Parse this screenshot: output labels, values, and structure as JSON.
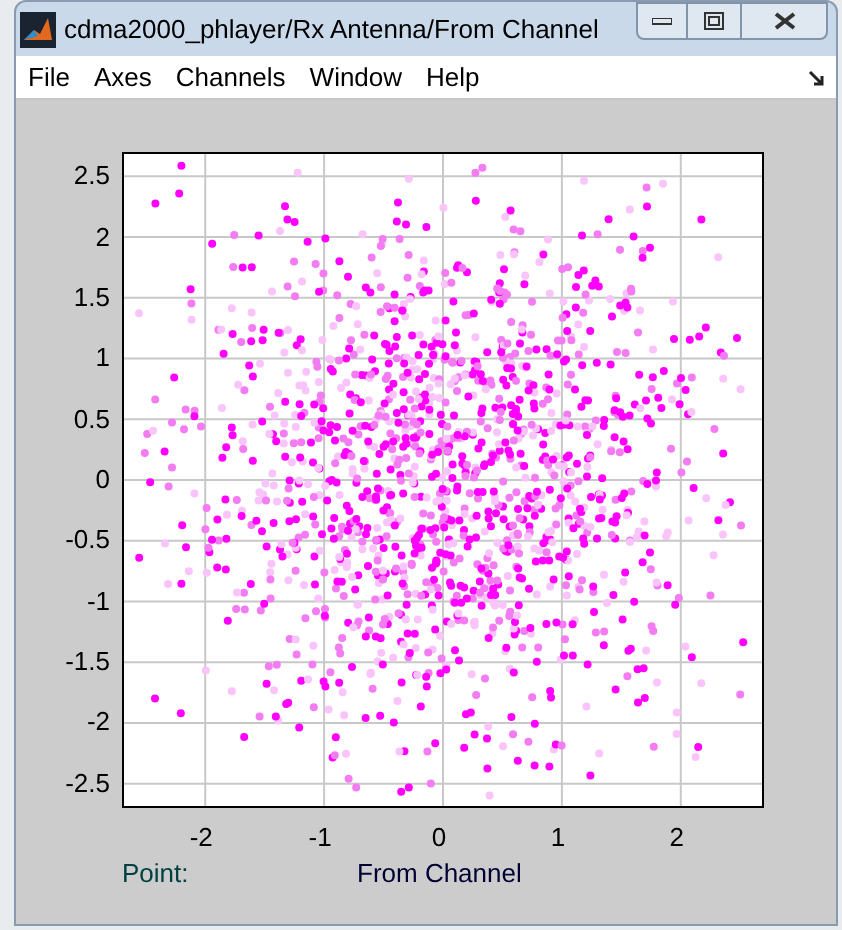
{
  "window": {
    "title": "cdma2000_phlayer/Rx Antenna/From Channel"
  },
  "menu": [
    "File",
    "Axes",
    "Channels",
    "Window",
    "Help"
  ],
  "plot": {
    "chart_data": {
      "type": "scatter",
      "grid": true,
      "xlabel": "From Channel",
      "xlim": [
        -2.7,
        2.7
      ],
      "ylim": [
        -2.7,
        2.7
      ],
      "xticks": [
        -2,
        -1,
        0,
        1,
        2
      ],
      "yticks": [
        -2.5,
        -2,
        -1.5,
        -1,
        -0.5,
        0,
        0.5,
        1,
        1.5,
        2,
        2.5
      ]
    },
    "point_readout": "Point:"
  }
}
